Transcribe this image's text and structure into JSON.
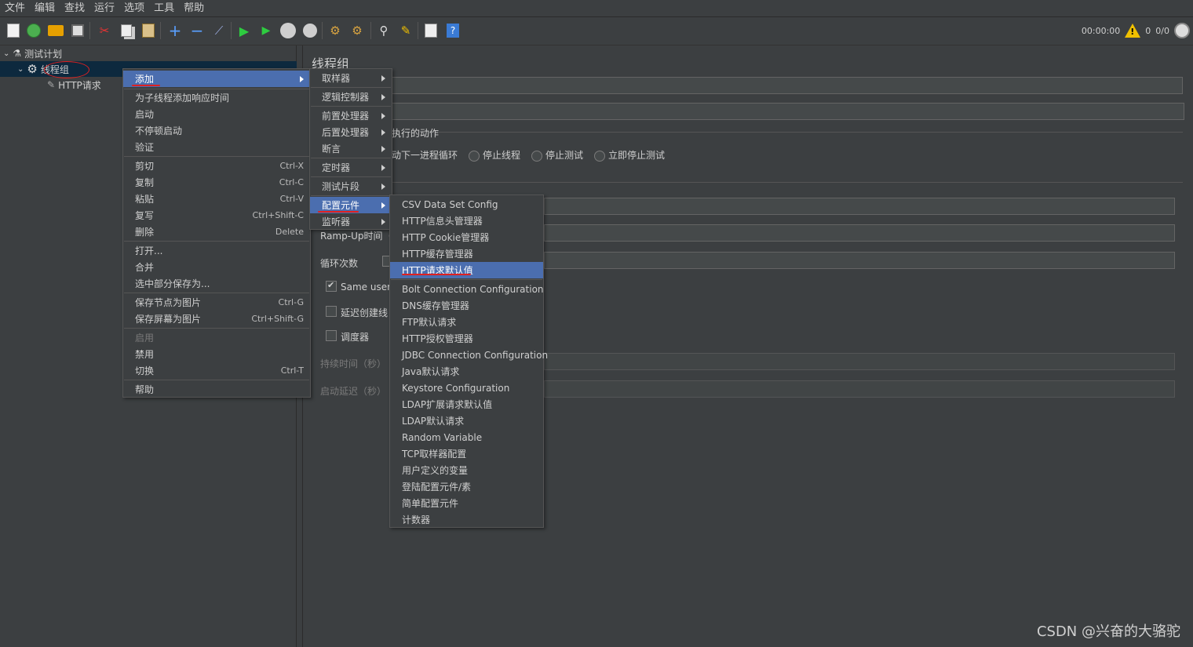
{
  "menubar": [
    "文件",
    "编辑",
    "查找",
    "运行",
    "选项",
    "工具",
    "帮助"
  ],
  "toolbar": {
    "icons": [
      "new-icon",
      "templates-icon",
      "open-icon",
      "save-icon",
      "cut-icon",
      "copy-icon",
      "paste-icon",
      "expand-icon",
      "collapse-icon",
      "toggle-icon",
      "start-icon",
      "start-no-pause-icon",
      "stop-icon",
      "shutdown-icon",
      "clear-icon",
      "clear-all-icon",
      "search-icon",
      "reset-search-icon",
      "function-helper-icon",
      "help-icon"
    ],
    "timer": "00:00:00",
    "warning_count": "0",
    "thread_count": "0/0"
  },
  "tree": {
    "test_plan": "测试计划",
    "thread_group": "线程组",
    "http_request": "HTTP请求"
  },
  "editor": {
    "title": "线程组",
    "error_action_label": "执行的动作",
    "radio_next_loop": "动下一进程循环",
    "radio_stop_thread": "停止线程",
    "radio_stop_test": "停止测试",
    "radio_stop_now": "立即停止测试",
    "rampup_label": "Ramp-Up时间（",
    "loop_label": "循环次数",
    "same_user_label": "Same user c",
    "delay_create_label": "延迟创建线",
    "scheduler_label": "调度器",
    "duration_label": "持续时间（秒）",
    "startup_delay_label": "启动延迟（秒）"
  },
  "context_menu": {
    "items": [
      {
        "label": "添加",
        "acc": "",
        "submenu": true
      },
      {
        "label": "为子线程添加响应时间",
        "acc": ""
      },
      {
        "label": "启动",
        "acc": ""
      },
      {
        "label": "不停顿启动",
        "acc": ""
      },
      {
        "label": "验证",
        "acc": ""
      },
      {
        "label": "剪切",
        "acc": "Ctrl-X"
      },
      {
        "label": "复制",
        "acc": "Ctrl-C"
      },
      {
        "label": "粘贴",
        "acc": "Ctrl-V"
      },
      {
        "label": "复写",
        "acc": "Ctrl+Shift-C"
      },
      {
        "label": "删除",
        "acc": "Delete"
      },
      {
        "label": "打开...",
        "acc": ""
      },
      {
        "label": "合并",
        "acc": ""
      },
      {
        "label": "选中部分保存为...",
        "acc": ""
      },
      {
        "label": "保存节点为图片",
        "acc": "Ctrl-G"
      },
      {
        "label": "保存屏幕为图片",
        "acc": "Ctrl+Shift-G"
      },
      {
        "label": "启用",
        "acc": "",
        "disabled": true
      },
      {
        "label": "禁用",
        "acc": ""
      },
      {
        "label": "切换",
        "acc": "Ctrl-T"
      },
      {
        "label": "帮助",
        "acc": ""
      }
    ]
  },
  "add_submenu": {
    "items": [
      "取样器",
      "逻辑控制器",
      "前置处理器",
      "后置处理器",
      "断言",
      "定时器",
      "测试片段",
      "配置元件",
      "监听器"
    ]
  },
  "config_submenu": {
    "items": [
      "CSV Data Set Config",
      "HTTP信息头管理器",
      "HTTP Cookie管理器",
      "HTTP缓存管理器",
      "HTTP请求默认值",
      "Bolt Connection Configuration",
      "DNS缓存管理器",
      "FTP默认请求",
      "HTTP授权管理器",
      "JDBC Connection Configuration",
      "Java默认请求",
      "Keystore Configuration",
      "LDAP扩展请求默认值",
      "LDAP默认请求",
      "Random Variable",
      "TCP取样器配置",
      "用户定义的变量",
      "登陆配置元件/素",
      "简单配置元件",
      "计数器"
    ]
  },
  "watermark": "CSDN @兴奋的大骆驼"
}
